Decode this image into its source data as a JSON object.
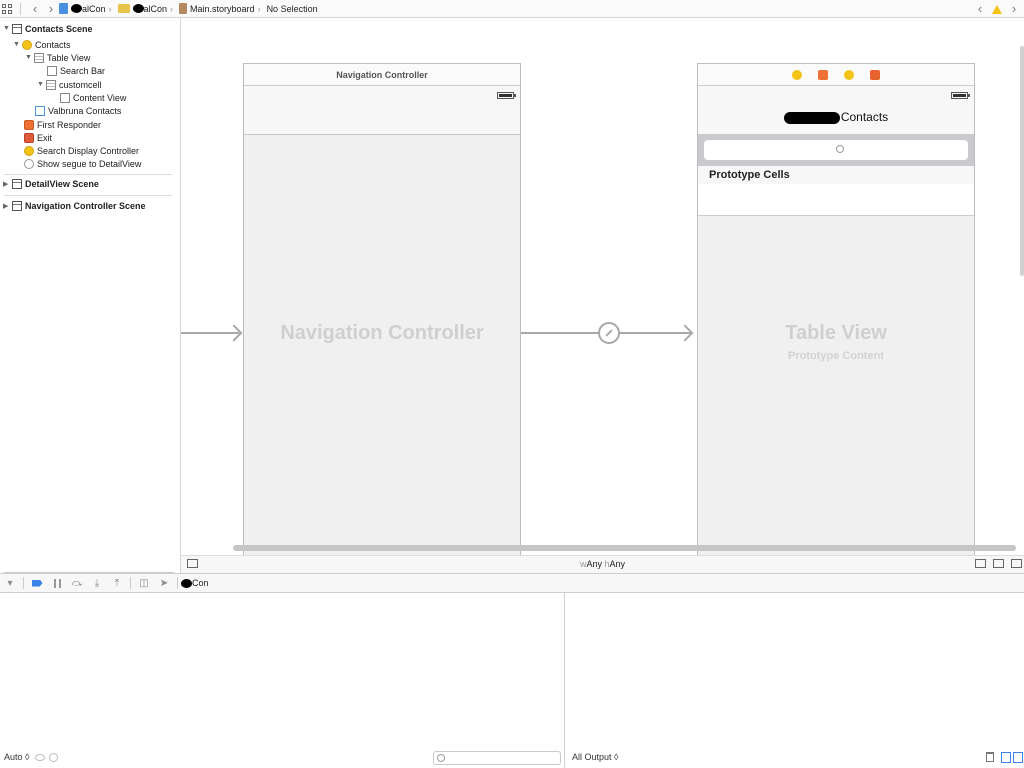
{
  "jumpbar": {
    "crumbs": [
      {
        "label": "alCon"
      },
      {
        "label": "alCon"
      },
      {
        "label": "Main.storyboard"
      },
      {
        "label": "No Selection"
      }
    ]
  },
  "outline": {
    "items": [
      {
        "label": "Contacts Scene"
      },
      {
        "label": "Contacts"
      },
      {
        "label": "Table View"
      },
      {
        "label": "Search Bar"
      },
      {
        "label": "customcell"
      },
      {
        "label": "Content View"
      },
      {
        "label": "Valbruna Contacts"
      },
      {
        "label": "First Responder"
      },
      {
        "label": "Exit"
      },
      {
        "label": "Search Display Controller"
      },
      {
        "label": "Show segue to DetailView"
      },
      {
        "label": "DetailView Scene"
      },
      {
        "label": "Navigation Controller Scene"
      }
    ]
  },
  "canvas": {
    "nav_controller": {
      "title": "Navigation Controller",
      "placeholder": "Navigation Controller"
    },
    "table_vc": {
      "nav_title": "Contacts",
      "prototype_header": "Prototype Cells",
      "placeholder": "Table View",
      "placeholder_sub": "Prototype Content"
    }
  },
  "sizebar": {
    "w_prefix": "w",
    "w_value": "Any",
    "h_prefix": "h",
    "h_value": "Any"
  },
  "debugbar": {
    "target": "Con"
  },
  "debug_area": {
    "vars_mode": "Auto ◊",
    "console_output": "All Output ◊"
  },
  "colors": {
    "accent": "#3b82e8",
    "warning": "#f3c317"
  }
}
